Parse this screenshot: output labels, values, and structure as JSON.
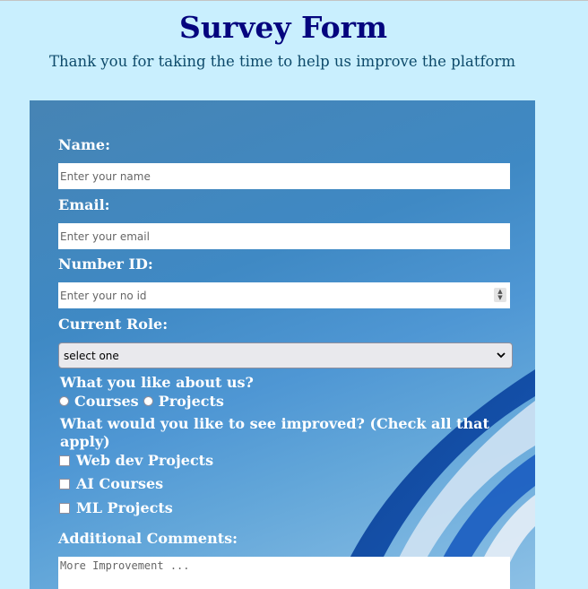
{
  "header": {
    "title": "Survey Form",
    "subtitle": "Thank you for taking the time to help us improve the platform"
  },
  "form": {
    "name": {
      "label": "Name:",
      "placeholder": "Enter your name"
    },
    "email": {
      "label": "Email:",
      "placeholder": "Enter your email"
    },
    "number_id": {
      "label": "Number ID:",
      "placeholder": "Enter your no id"
    },
    "role": {
      "label": "Current Role:",
      "selected": "select one"
    },
    "like": {
      "question": "What you like about us?",
      "options": [
        "Courses",
        "Projects"
      ]
    },
    "improve": {
      "question": "What would you like to see improved? (Check all that apply)",
      "options": [
        "Web dev Projects",
        "AI Courses",
        "ML Projects"
      ]
    },
    "comments": {
      "label": "Additional Comments:",
      "placeholder": "More Improvement ..."
    }
  },
  "colors": {
    "page_bg": "#c9effe",
    "title": "#05057e",
    "subtitle": "#0d4a6a",
    "panel": "#4684b4"
  },
  "icons": {
    "spinner": "number-spinner-icon",
    "select": "chevron-down-icon"
  }
}
